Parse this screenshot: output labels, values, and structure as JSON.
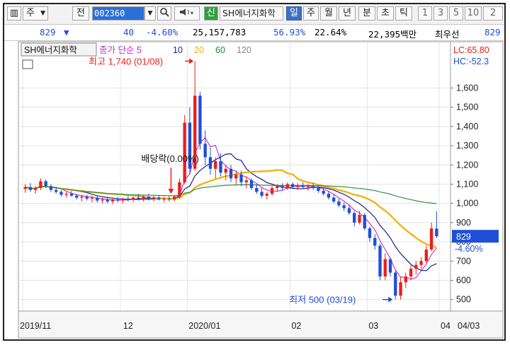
{
  "toolbar": {
    "market": "주",
    "prev": "전",
    "code": "002360",
    "search_icon": "magnifier-icon",
    "sound_icon": "speaker-icon",
    "new_badge": "신",
    "stock_name": "SH에너지화학",
    "periods": [
      "일",
      "주",
      "월",
      "년",
      "분",
      "초",
      "틱"
    ],
    "active_period": "일",
    "numbers": [
      "1",
      "3",
      "5",
      "10",
      "2"
    ]
  },
  "info_bar": {
    "price": "829",
    "arrow": "▼",
    "change": "40",
    "change_pct": "-4.60%",
    "volume": "25,157,783",
    "ratio1": "56.93%",
    "ratio2": "22.64%",
    "market_cap": "22,395백만",
    "quote_type": "최우선",
    "quote_price": "829"
  },
  "colors": {
    "up": "#e8201c",
    "down": "#1f4fd8",
    "ma5": "#c02ec8",
    "ma10": "#1c1f8c",
    "ma20": "#f0b000",
    "ma60": "#1f8a3a",
    "ma120": "#888888",
    "price_box": "#1f4fd8"
  },
  "chart_data": {
    "type": "candlestick",
    "title": "SH에너지화학",
    "legend": {
      "label": "종가 단순",
      "periods": [
        "5",
        "10",
        "20",
        "60",
        "120"
      ]
    },
    "top_right": {
      "lc": "LC:65.80",
      "hc": "HC:-52.3"
    },
    "x_ticks": [
      "2019/11",
      "12",
      "2020/01",
      "02",
      "03",
      "04",
      "04/03"
    ],
    "y_ticks": [
      500,
      600,
      700,
      800,
      900,
      1000,
      1100,
      1200,
      1300,
      1400,
      1500,
      1600
    ],
    "ylim": [
      440,
      1760
    ],
    "current_price": {
      "value": 829,
      "label": "829",
      "change": "-4.60%"
    },
    "annotations": {
      "high": "최고 1,740 (01/08)",
      "dividend": "배당락(0.00%)",
      "low": "최저 500 (03/19)"
    },
    "candles": [
      {
        "o": 1075,
        "h": 1100,
        "l": 1055,
        "c": 1085
      },
      {
        "o": 1085,
        "h": 1105,
        "l": 1060,
        "c": 1070
      },
      {
        "o": 1070,
        "h": 1090,
        "l": 1050,
        "c": 1080
      },
      {
        "o": 1080,
        "h": 1130,
        "l": 1070,
        "c": 1115
      },
      {
        "o": 1115,
        "h": 1125,
        "l": 1080,
        "c": 1090
      },
      {
        "o": 1090,
        "h": 1100,
        "l": 1060,
        "c": 1070
      },
      {
        "o": 1070,
        "h": 1085,
        "l": 1050,
        "c": 1060
      },
      {
        "o": 1060,
        "h": 1070,
        "l": 1035,
        "c": 1045
      },
      {
        "o": 1045,
        "h": 1060,
        "l": 1030,
        "c": 1050
      },
      {
        "o": 1050,
        "h": 1065,
        "l": 1035,
        "c": 1040
      },
      {
        "o": 1040,
        "h": 1050,
        "l": 1020,
        "c": 1030
      },
      {
        "o": 1030,
        "h": 1045,
        "l": 1010,
        "c": 1035
      },
      {
        "o": 1035,
        "h": 1045,
        "l": 1015,
        "c": 1025
      },
      {
        "o": 1025,
        "h": 1040,
        "l": 1005,
        "c": 1030
      },
      {
        "o": 1030,
        "h": 1040,
        "l": 1005,
        "c": 1015
      },
      {
        "o": 1015,
        "h": 1030,
        "l": 1000,
        "c": 1020
      },
      {
        "o": 1020,
        "h": 1035,
        "l": 1000,
        "c": 1010
      },
      {
        "o": 1010,
        "h": 1030,
        "l": 995,
        "c": 1020
      },
      {
        "o": 1020,
        "h": 1035,
        "l": 1005,
        "c": 1015
      },
      {
        "o": 1015,
        "h": 1030,
        "l": 1000,
        "c": 1025
      },
      {
        "o": 1025,
        "h": 1040,
        "l": 1010,
        "c": 1020
      },
      {
        "o": 1020,
        "h": 1035,
        "l": 1005,
        "c": 1030
      },
      {
        "o": 1030,
        "h": 1050,
        "l": 1015,
        "c": 1025
      },
      {
        "o": 1025,
        "h": 1045,
        "l": 1010,
        "c": 1035
      },
      {
        "o": 1035,
        "h": 1050,
        "l": 1015,
        "c": 1025
      },
      {
        "o": 1025,
        "h": 1040,
        "l": 1010,
        "c": 1030
      },
      {
        "o": 1030,
        "h": 1045,
        "l": 1015,
        "c": 1020
      },
      {
        "o": 1020,
        "h": 1035,
        "l": 1005,
        "c": 1025
      },
      {
        "o": 1025,
        "h": 1040,
        "l": 1010,
        "c": 1020
      },
      {
        "o": 1020,
        "h": 1045,
        "l": 1010,
        "c": 1035
      },
      {
        "o": 1035,
        "h": 1130,
        "l": 1025,
        "c": 1110
      },
      {
        "o": 1110,
        "h": 1460,
        "l": 1100,
        "c": 1420
      },
      {
        "o": 1420,
        "h": 1500,
        "l": 1150,
        "c": 1180
      },
      {
        "o": 1180,
        "h": 1740,
        "l": 1170,
        "c": 1560
      },
      {
        "o": 1560,
        "h": 1580,
        "l": 1280,
        "c": 1310
      },
      {
        "o": 1310,
        "h": 1380,
        "l": 1200,
        "c": 1240
      },
      {
        "o": 1240,
        "h": 1290,
        "l": 1150,
        "c": 1180
      },
      {
        "o": 1180,
        "h": 1240,
        "l": 1130,
        "c": 1220
      },
      {
        "o": 1220,
        "h": 1260,
        "l": 1140,
        "c": 1160
      },
      {
        "o": 1160,
        "h": 1200,
        "l": 1120,
        "c": 1180
      },
      {
        "o": 1180,
        "h": 1200,
        "l": 1110,
        "c": 1130
      },
      {
        "o": 1130,
        "h": 1170,
        "l": 1100,
        "c": 1150
      },
      {
        "o": 1150,
        "h": 1170,
        "l": 1090,
        "c": 1110
      },
      {
        "o": 1110,
        "h": 1140,
        "l": 1080,
        "c": 1120
      },
      {
        "o": 1120,
        "h": 1130,
        "l": 1070,
        "c": 1080
      },
      {
        "o": 1080,
        "h": 1100,
        "l": 1050,
        "c": 1060
      },
      {
        "o": 1060,
        "h": 1080,
        "l": 1030,
        "c": 1040
      },
      {
        "o": 1040,
        "h": 1060,
        "l": 1020,
        "c": 1050
      },
      {
        "o": 1050,
        "h": 1090,
        "l": 1040,
        "c": 1080
      },
      {
        "o": 1080,
        "h": 1100,
        "l": 1060,
        "c": 1090
      },
      {
        "o": 1090,
        "h": 1105,
        "l": 1070,
        "c": 1080
      },
      {
        "o": 1080,
        "h": 1110,
        "l": 1070,
        "c": 1100
      },
      {
        "o": 1100,
        "h": 1110,
        "l": 1075,
        "c": 1085
      },
      {
        "o": 1085,
        "h": 1105,
        "l": 1070,
        "c": 1095
      },
      {
        "o": 1095,
        "h": 1110,
        "l": 1075,
        "c": 1085
      },
      {
        "o": 1085,
        "h": 1100,
        "l": 1065,
        "c": 1090
      },
      {
        "o": 1090,
        "h": 1105,
        "l": 1070,
        "c": 1080
      },
      {
        "o": 1080,
        "h": 1095,
        "l": 1055,
        "c": 1065
      },
      {
        "o": 1065,
        "h": 1080,
        "l": 1040,
        "c": 1050
      },
      {
        "o": 1050,
        "h": 1065,
        "l": 1020,
        "c": 1030
      },
      {
        "o": 1030,
        "h": 1045,
        "l": 1000,
        "c": 1010
      },
      {
        "o": 1010,
        "h": 1025,
        "l": 980,
        "c": 990
      },
      {
        "o": 990,
        "h": 1005,
        "l": 960,
        "c": 975
      },
      {
        "o": 975,
        "h": 990,
        "l": 940,
        "c": 950
      },
      {
        "o": 950,
        "h": 960,
        "l": 880,
        "c": 900
      },
      {
        "o": 900,
        "h": 960,
        "l": 890,
        "c": 940
      },
      {
        "o": 940,
        "h": 950,
        "l": 860,
        "c": 870
      },
      {
        "o": 870,
        "h": 880,
        "l": 800,
        "c": 820
      },
      {
        "o": 820,
        "h": 840,
        "l": 760,
        "c": 780
      },
      {
        "o": 780,
        "h": 790,
        "l": 600,
        "c": 620
      },
      {
        "o": 620,
        "h": 740,
        "l": 600,
        "c": 710
      },
      {
        "o": 710,
        "h": 720,
        "l": 620,
        "c": 640
      },
      {
        "o": 640,
        "h": 650,
        "l": 500,
        "c": 520
      },
      {
        "o": 520,
        "h": 620,
        "l": 500,
        "c": 590
      },
      {
        "o": 590,
        "h": 640,
        "l": 560,
        "c": 620
      },
      {
        "o": 620,
        "h": 680,
        "l": 600,
        "c": 660
      },
      {
        "o": 660,
        "h": 700,
        "l": 630,
        "c": 680
      },
      {
        "o": 680,
        "h": 720,
        "l": 660,
        "c": 700
      },
      {
        "o": 700,
        "h": 780,
        "l": 690,
        "c": 760
      },
      {
        "o": 760,
        "h": 900,
        "l": 750,
        "c": 870
      },
      {
        "o": 869,
        "h": 960,
        "l": 820,
        "c": 829
      }
    ]
  }
}
